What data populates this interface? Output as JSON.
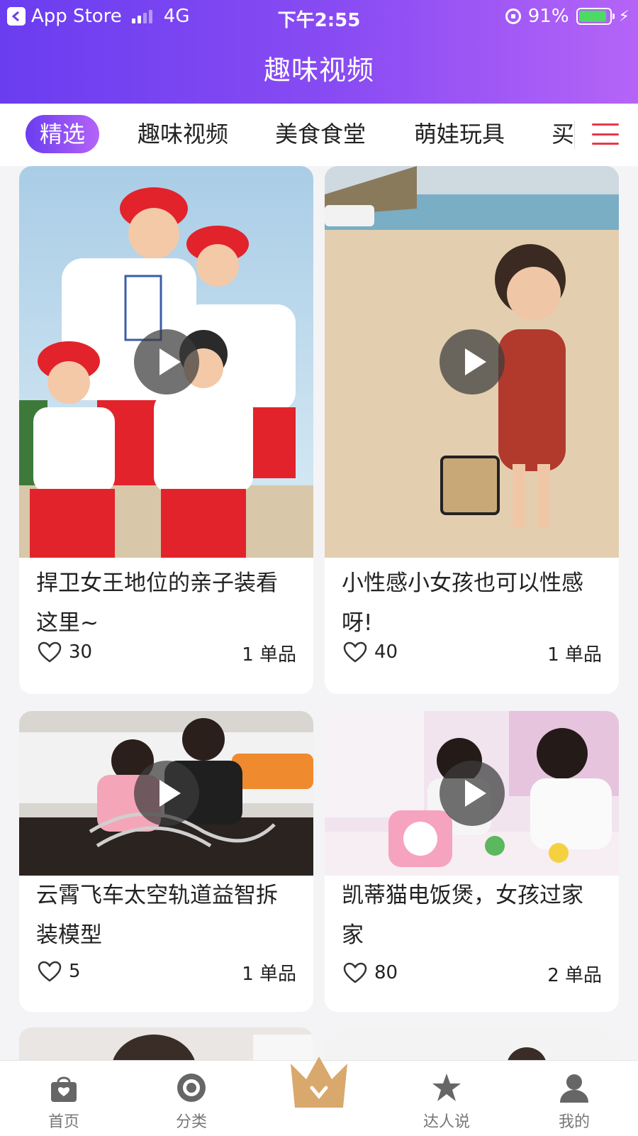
{
  "status_bar": {
    "back_app": "App Store",
    "network": "4G",
    "time": "下午2:55",
    "battery": "91%",
    "battery_level": 0.91
  },
  "header": {
    "title": "趣味视频"
  },
  "tabs": [
    {
      "label": "精选",
      "active": true
    },
    {
      "label": "趣味视频"
    },
    {
      "label": "美食食堂"
    },
    {
      "label": "萌娃玩具"
    },
    {
      "label": "买"
    }
  ],
  "feed": [
    {
      "title": "捍卫女王地位的亲子装看这里~",
      "likes": "30",
      "count": "1 单品"
    },
    {
      "title": "小性感小女孩也可以性感呀!",
      "likes": "40",
      "count": "1 单品"
    },
    {
      "title": "云霄飞车太空轨道益智拆装模型",
      "likes": "5",
      "count": "1 单品"
    },
    {
      "title": "凯蒂猫电饭煲，女孩过家家",
      "likes": "80",
      "count": "2 单品"
    }
  ],
  "bottom_nav": [
    {
      "label": "首页",
      "icon": "bag-icon"
    },
    {
      "label": "分类",
      "icon": "target-icon"
    },
    {
      "label": "",
      "icon": "crown-icon"
    },
    {
      "label": "达人说",
      "icon": "star-icon"
    },
    {
      "label": "我的",
      "icon": "user-icon"
    }
  ],
  "colors": {
    "header_gradient": [
      "#6a3df0",
      "#b564f7"
    ],
    "menu_accent": "#e6394a",
    "crown": "#d9a86c"
  }
}
